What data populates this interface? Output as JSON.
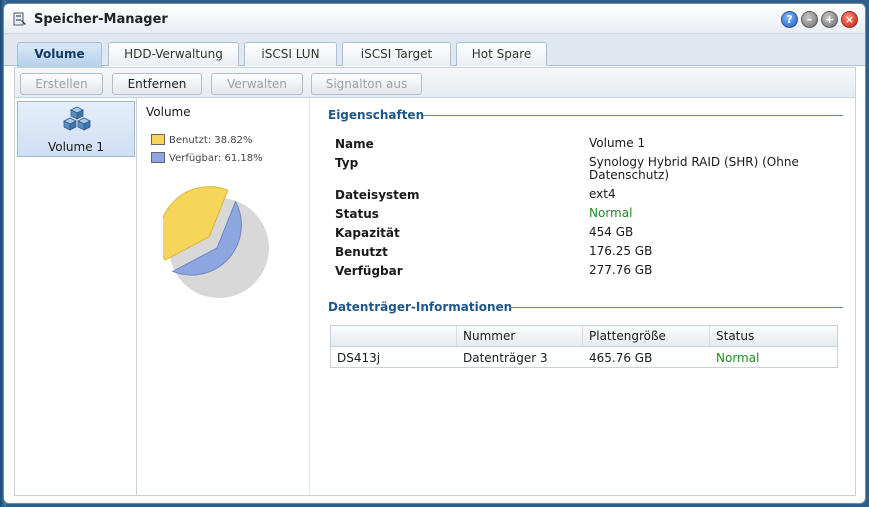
{
  "window": {
    "title": "Speicher-Manager"
  },
  "tabs": [
    {
      "label": "Volume",
      "active": true
    },
    {
      "label": "HDD-Verwaltung",
      "active": false
    },
    {
      "label": "iSCSI LUN",
      "active": false
    },
    {
      "label": "iSCSI Target",
      "active": false
    },
    {
      "label": "Hot Spare",
      "active": false
    }
  ],
  "toolbar": {
    "create_label": "Erstellen",
    "remove_label": "Entfernen",
    "manage_label": "Verwalten",
    "beep_off_label": "Signalton aus"
  },
  "volumes": [
    {
      "label": "Volume 1",
      "selected": true
    }
  ],
  "usage": {
    "title": "Volume",
    "used_legend": "Benutzt: 38.82%",
    "free_legend": "Verfügbar: 61.18%",
    "used_percent": 38.82,
    "free_percent": 61.18,
    "used_color": "#f5d55a",
    "free_color": "#8ea6e0"
  },
  "properties": {
    "heading": "Eigenschaften",
    "rows": [
      {
        "key": "Name",
        "value": "Volume 1"
      },
      {
        "key": "Typ",
        "value": "Synology Hybrid RAID (SHR) (Ohne Datenschutz)"
      },
      {
        "key": "Dateisystem",
        "value": "ext4"
      },
      {
        "key": "Status",
        "value": "Normal"
      },
      {
        "key": "Kapazität",
        "value": "454 GB"
      },
      {
        "key": "Benutzt",
        "value": "176.25 GB"
      },
      {
        "key": "Verfügbar",
        "value": "277.76 GB"
      }
    ]
  },
  "disks": {
    "heading": "Datenträger-Informationen",
    "columns": [
      "",
      "Nummer",
      "Plattengröße",
      "Status"
    ],
    "rows": [
      {
        "device": "DS413j",
        "number": "Datenträger 3",
        "size": "465.76 GB",
        "status": "Normal"
      }
    ]
  },
  "colors": {
    "status_ok": "#1f8a1f",
    "accent": "#1f5788"
  }
}
